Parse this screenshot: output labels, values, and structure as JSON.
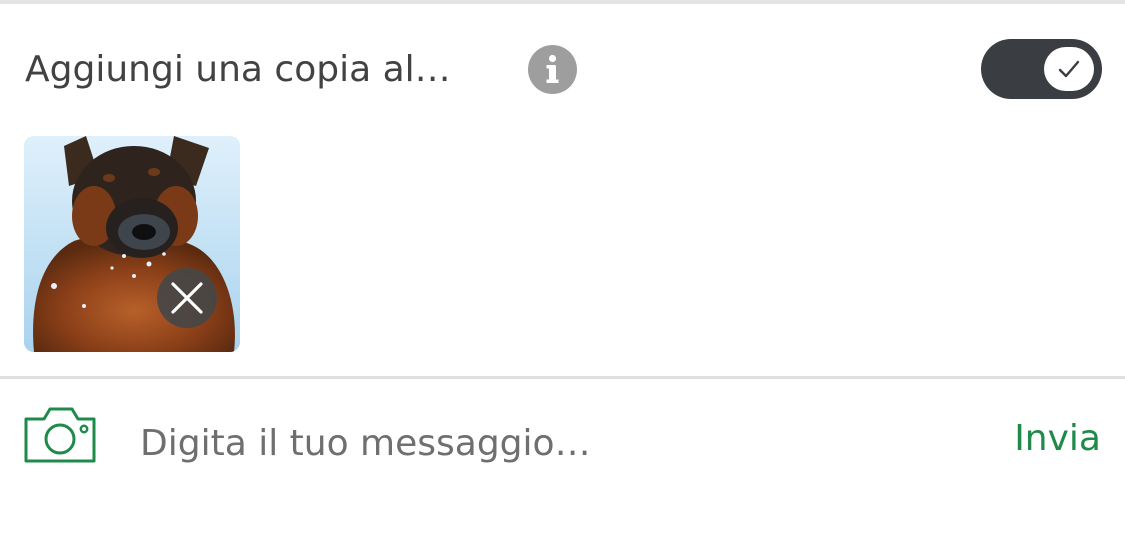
{
  "copy_option": {
    "label": "Aggiungi una copia al…",
    "info_icon": "info-icon",
    "toggle_on": true,
    "toggle_icon": "checkmark-icon"
  },
  "attachment": {
    "thumbnail_icon": "photo-thumbnail",
    "remove_icon": "close-icon"
  },
  "composer": {
    "camera_icon": "camera-icon",
    "message_placeholder": "Digita il tuo messaggio…",
    "message_value": "",
    "send_label": "Invia"
  },
  "colors": {
    "accent_green": "#1f8a4a",
    "toggle_track": "#3a3d42",
    "info_gray": "#9e9e9e",
    "text_dark": "#424242"
  }
}
